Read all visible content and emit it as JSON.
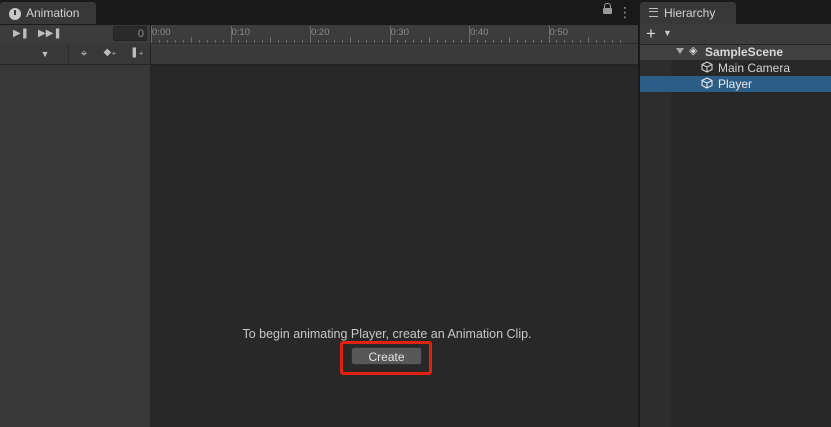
{
  "animation": {
    "tab_label": "Animation",
    "frame_value": "0",
    "ruler_ticks": [
      "0:00",
      "0:10",
      "0:20",
      "0:30",
      "0:40",
      "0:50"
    ],
    "empty_message": "To begin animating Player, create an Animation Clip.",
    "create_label": "Create"
  },
  "hierarchy": {
    "tab_label": "Hierarchy",
    "items": [
      {
        "label": "SampleScene",
        "icon": "unity-scene-icon"
      },
      {
        "label": "Main Camera",
        "icon": "gameobject-cube-icon"
      },
      {
        "label": "Player",
        "icon": "gameobject-cube-icon",
        "selected": true
      }
    ]
  },
  "colors": {
    "highlight_border": "#e0220f",
    "selection": "#2c5d87"
  }
}
